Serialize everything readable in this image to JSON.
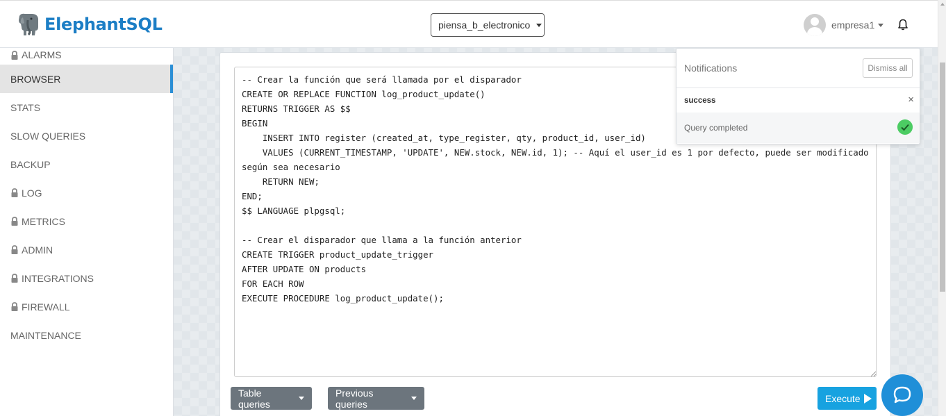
{
  "header": {
    "brand": "ElephantSQL",
    "database": "piensa_b_electronico",
    "user": "empresa1"
  },
  "sidebar": {
    "items": [
      {
        "label": "ALARMS",
        "locked": true
      },
      {
        "label": "BROWSER",
        "locked": false,
        "active": true
      },
      {
        "label": "STATS",
        "locked": false
      },
      {
        "label": "SLOW QUERIES",
        "locked": false
      },
      {
        "label": "BACKUP",
        "locked": false
      },
      {
        "label": "LOG",
        "locked": true
      },
      {
        "label": "METRICS",
        "locked": true
      },
      {
        "label": "ADMIN",
        "locked": true
      },
      {
        "label": "INTEGRATIONS",
        "locked": true
      },
      {
        "label": "FIREWALL",
        "locked": true
      },
      {
        "label": "MAINTENANCE",
        "locked": false
      }
    ]
  },
  "editor": {
    "query": "-- Crear la función que será llamada por el disparador\nCREATE OR REPLACE FUNCTION log_product_update()\nRETURNS TRIGGER AS $$\nBEGIN\n    INSERT INTO register (created_at, type_register, qty, product_id, user_id)\n    VALUES (CURRENT_TIMESTAMP, 'UPDATE', NEW.stock, NEW.id, 1); -- Aquí el user_id es 1 por defecto, puede ser modificado según sea necesario\n    RETURN NEW;\nEND;\n$$ LANGUAGE plpgsql;\n\n-- Crear el disparador que llama a la función anterior\nCREATE TRIGGER product_update_trigger\nAFTER UPDATE ON products\nFOR EACH ROW\nEXECUTE PROCEDURE log_product_update();"
  },
  "buttons": {
    "table_queries": "Table queries",
    "previous_queries": "Previous queries",
    "execute": "Execute"
  },
  "notifications": {
    "title": "Notifications",
    "dismiss_all": "Dismiss all",
    "type": "success",
    "message": "Query completed",
    "close": "×"
  },
  "colors": {
    "brand": "#1c7ec5",
    "active_indicator": "#2b8fd6",
    "execute": "#17a2e0",
    "success": "#4ccc63",
    "chat": "#1f8fd8"
  }
}
